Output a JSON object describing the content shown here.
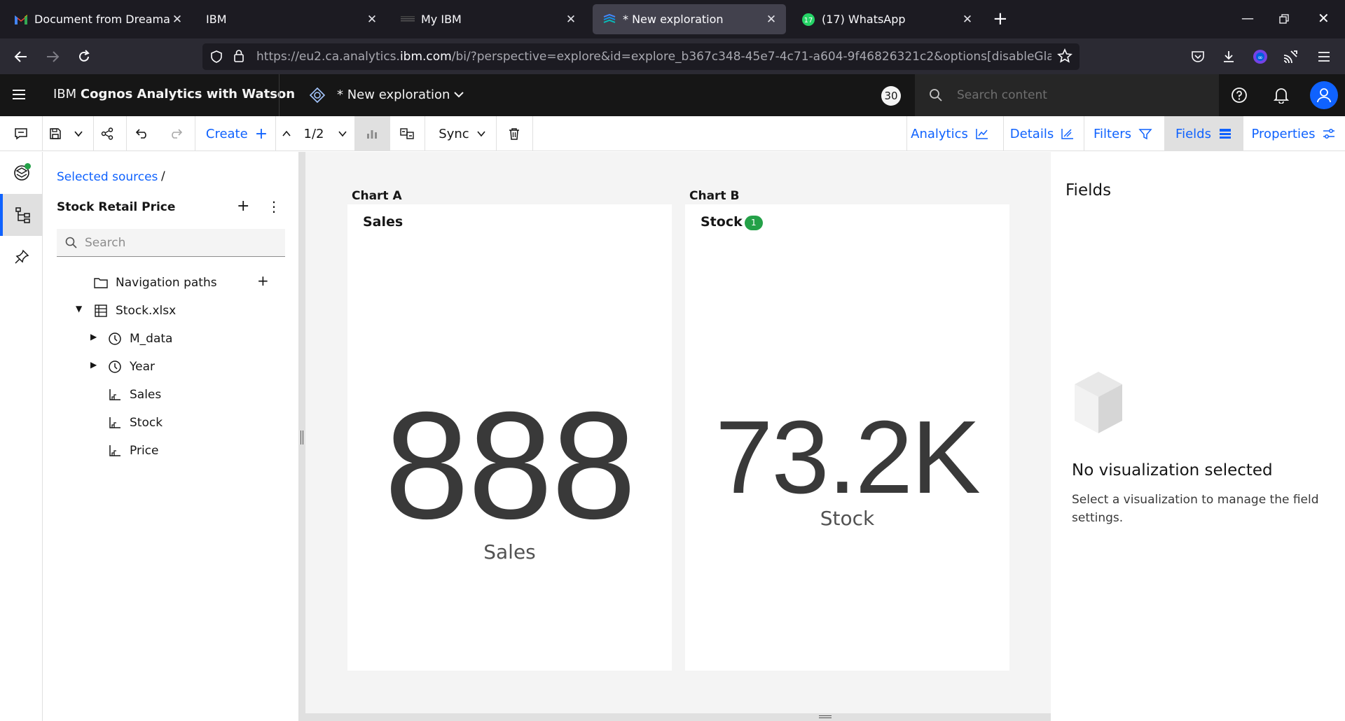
{
  "browser": {
    "tabs": [
      {
        "title": "Document from Dreamabi ✨ - ",
        "icon": "gmail-icon"
      },
      {
        "title": "IBM",
        "icon": "none"
      },
      {
        "title": "My IBM",
        "icon": "ibm-icon"
      },
      {
        "title": "* New exploration",
        "icon": "cognos-icon",
        "active": true
      },
      {
        "title": "(17) WhatsApp",
        "icon": "whatsapp-icon",
        "badge": "17"
      }
    ],
    "url_prefix": "https://eu2.ca.analytics.",
    "url_domain": "ibm.com",
    "url_rest": "/bi/?perspective=explore&id=explore_b367c348-45e7-4c71-a604-9f46826321c2&options[disableGlassPrefetch]=true"
  },
  "header": {
    "app_name_prefix": "IBM ",
    "app_name": "Cognos Analytics with Watson",
    "doc_title": "* New exploration",
    "notification_count": "30",
    "search_placeholder": "Search content"
  },
  "toolbar": {
    "create_label": "Create",
    "page_indicator": "1/2",
    "sync_label": "Sync",
    "analytics_label": "Analytics",
    "details_label": "Details",
    "filters_label": "Filters",
    "fields_label": "Fields",
    "properties_label": "Properties"
  },
  "sources": {
    "breadcrumb": "Selected sources",
    "breadcrumb_sep": "/",
    "title": "Stock Retail Price",
    "search_placeholder": "Search",
    "tree": [
      {
        "label": "Navigation paths",
        "icon": "folder-icon"
      },
      {
        "label": "Stock.xlsx",
        "icon": "table-icon"
      },
      {
        "label": "M_data",
        "icon": "clock-icon"
      },
      {
        "label": "Year",
        "icon": "clock-icon"
      },
      {
        "label": "Sales",
        "icon": "measure-icon"
      },
      {
        "label": "Stock",
        "icon": "measure-icon"
      },
      {
        "label": "Price",
        "icon": "measure-icon"
      }
    ]
  },
  "canvas": {
    "chart_a": {
      "header": "Chart A",
      "title": "Sales",
      "value": "888",
      "label": "Sales"
    },
    "chart_b": {
      "header": "Chart B",
      "title": "Stock",
      "badge": "1",
      "value": "73.2K",
      "label": "Stock"
    }
  },
  "fields_panel": {
    "title": "Fields",
    "empty_title": "No visualization selected",
    "empty_desc": "Select a visualization to manage the field settings."
  }
}
